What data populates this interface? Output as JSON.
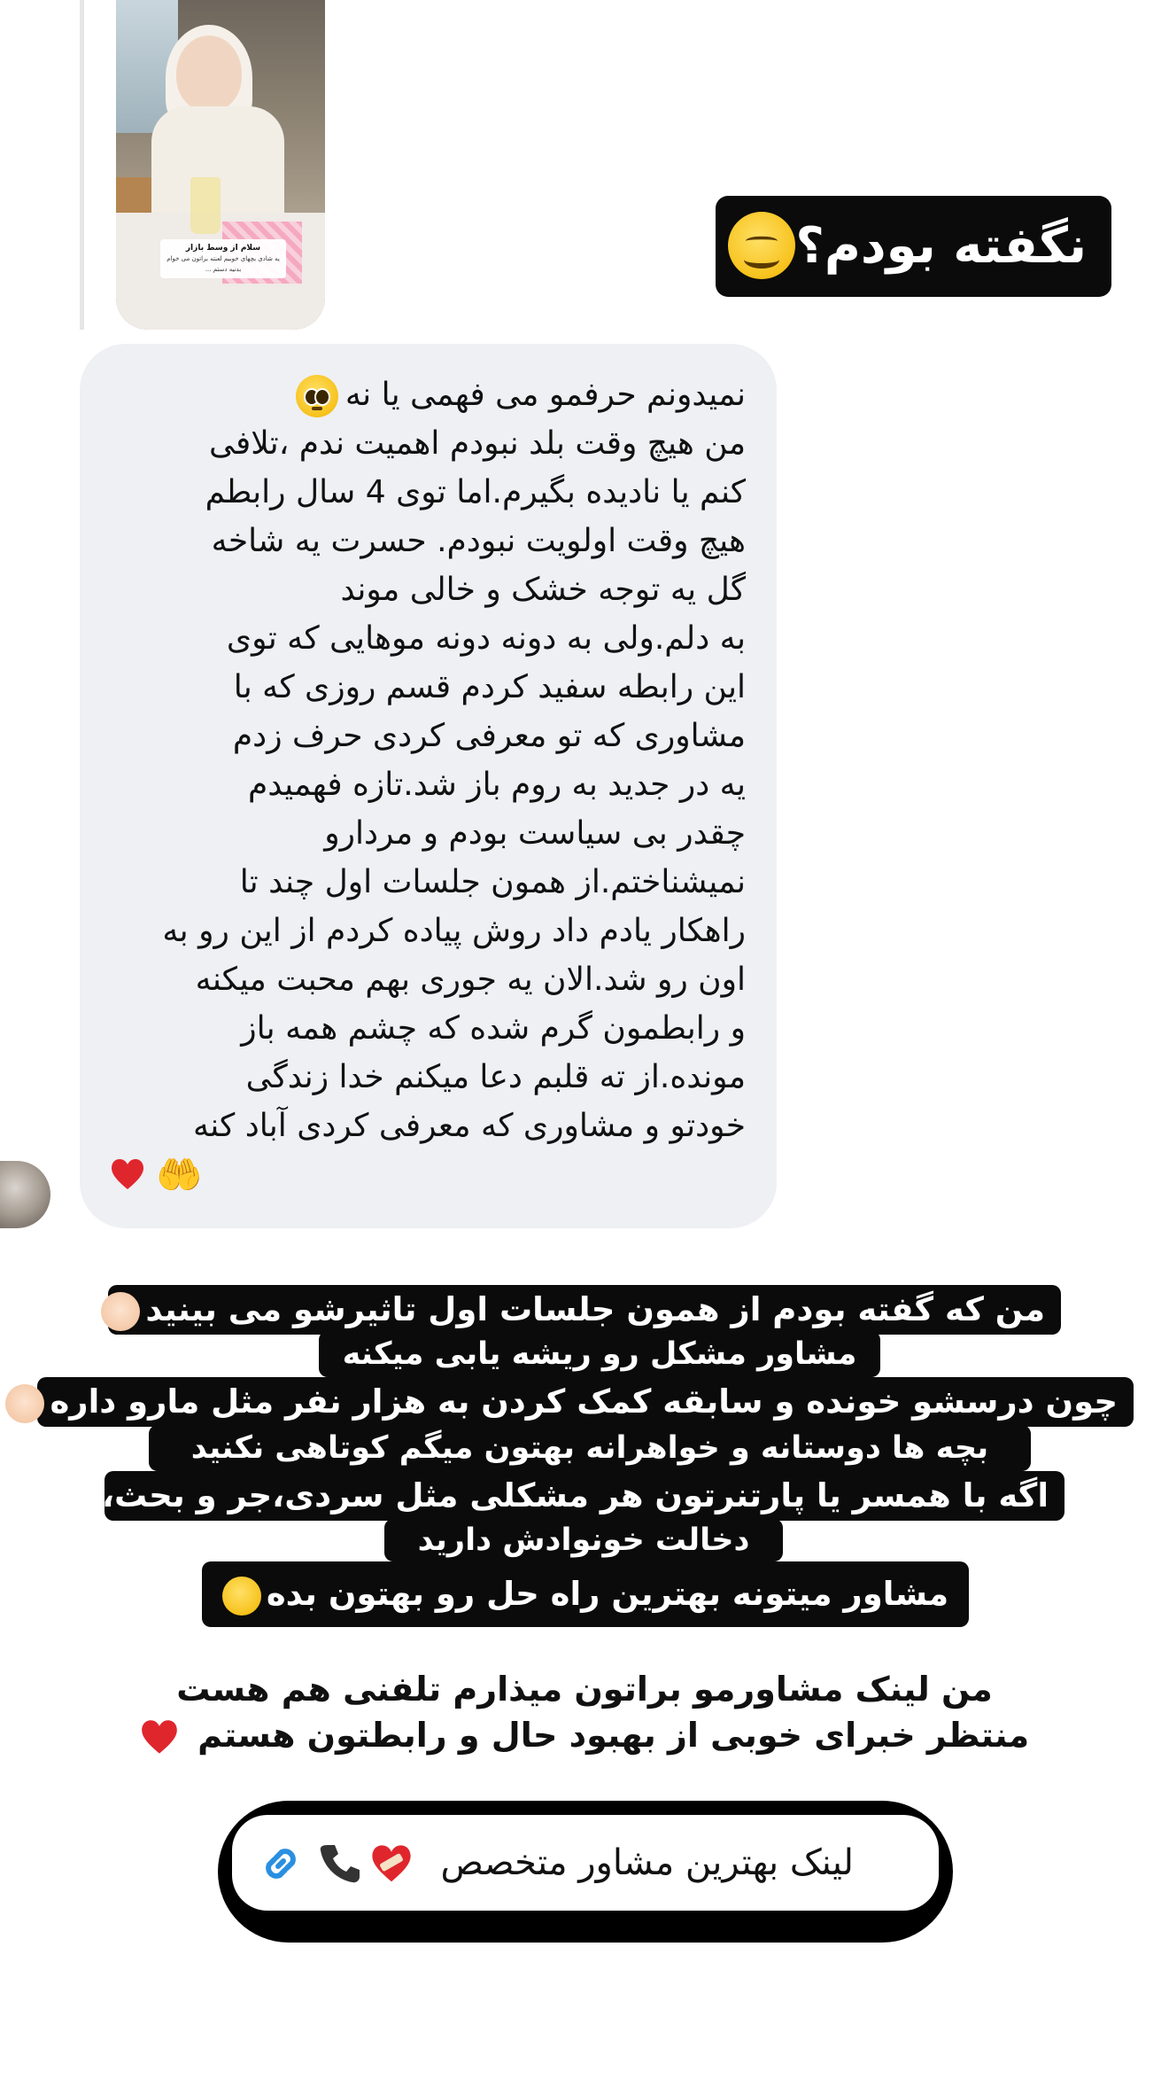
{
  "story": {
    "caption_title": "سلام از وسط بازار",
    "caption_body": "یه شادی بچهای خوبیم لعنته\nبراتون می خوام بدنیه دستم ..."
  },
  "label_top": {
    "text": "نگفته بودم؟",
    "emoji": "smiling-face-icon"
  },
  "message": {
    "lines": [
      "نمیدونم حرفمو می فهمی یا نه",
      "من هیچ وقت بلد نبودم اهمیت ندم ،تلافی",
      "کنم یا نادیده بگیرم.اما توی 4 سال رابطم",
      "هیچ وقت اولویت نبودم. حسرت یه شاخه",
      "گل یه توجه خشک و خالی موند",
      "به دلم.ولی به دونه دونه موهایی که توی",
      "این رابطه سفید کردم قسم روزی که با",
      "مشاوری که تو معرفی کردی حرف زدم",
      "یه در جدید به روم باز شد.تازه فهمیدم",
      "چقدر بی سیاست بودم و مردارو",
      "نمیشناختم.از همون جلسات اول چند تا",
      "راهکار یادم داد روش پیاده کردم از این رو به",
      "اون رو شد.الان یه جوری بهم محبت میکنه",
      "و رابطمون گرم شده که چشم همه باز",
      "مونده.از ته قلبم دعا میکنم خدا زندگی",
      "خودتو و مشاوری که معرفی کردی آباد کنه"
    ],
    "end_emojis": [
      "red-heart-icon",
      "raised-hands-icon"
    ],
    "hands_glyph": "🤲"
  },
  "promo": {
    "lines": [
      "من که گفته بودم از همون جلسات اول تاثیرشو می بینید",
      "مشاور مشکل رو ریشه یابی میکنه",
      "چون درسشو خونده و سابقه کمک کردن به هزار نفر مثل مارو داره",
      "بچه ها دوستانه و خواهرانه بهتون میگم کوتاهی نکنید",
      "اگه با همسر یا پارتنرتون هر مشکلی مثل سردی،جر و بحث،",
      "دخالت خونوادش دارید",
      "مشاور میتونه بهترین راه حل رو بهتون بده"
    ],
    "footer_lines": [
      "من لینک مشاورمو براتون میذارم تلفنی هم هست",
      "منتظر خبرای خوبی از بهبود حال و رابطتون هستم"
    ]
  },
  "link_button": {
    "label": "لینک بهترین مشاور متخصص",
    "icons": [
      "mending-heart-icon",
      "phone-icon",
      "link-icon"
    ]
  },
  "colors": {
    "bubble_bg": "#eef0f3",
    "label_bg": "#0b0b0b",
    "heart_red": "#e0262d",
    "link_blue": "#2a8fe0"
  }
}
